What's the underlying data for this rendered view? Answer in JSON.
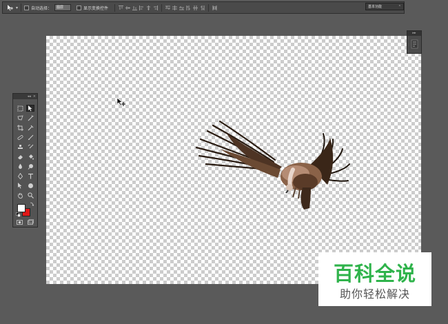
{
  "options_bar": {
    "auto_select_label": "自动选择：",
    "auto_select_value": "图层",
    "show_transform_label": "显示变换控件"
  },
  "workspace": {
    "label": "基本功能"
  },
  "tools_panel": {
    "foreground_color": "#ffffff",
    "background_color": "#e01818"
  },
  "document": {
    "background": "transparent-checkerboard",
    "layer_content": "vulture-in-flight"
  },
  "watermark": {
    "title": "百科全说",
    "subtitle": "助你轻松解决",
    "title_color": "#2fb34b"
  }
}
